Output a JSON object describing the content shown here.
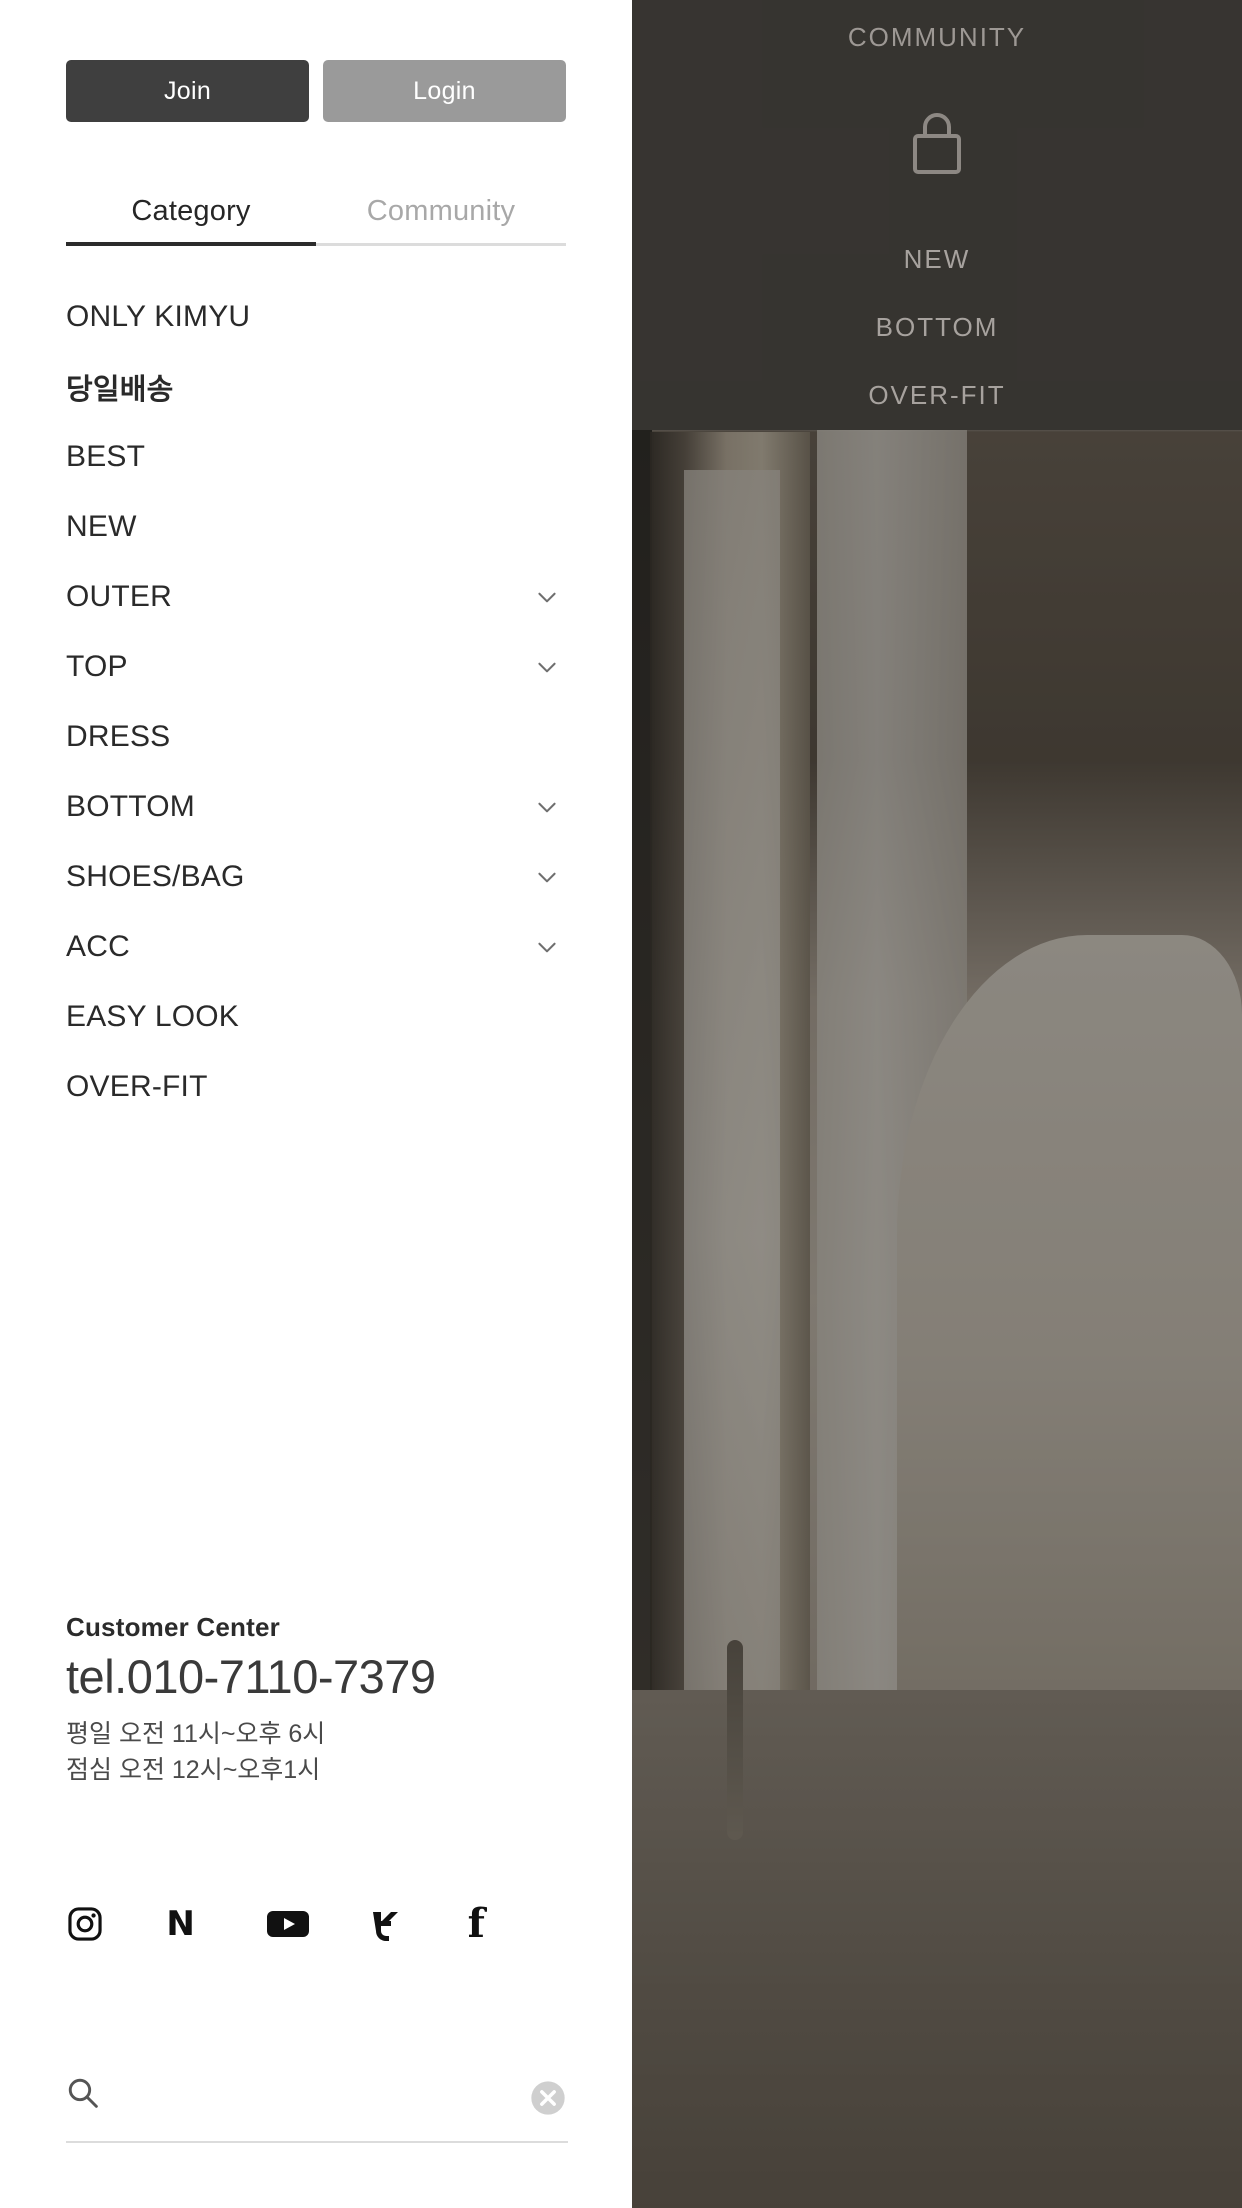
{
  "auth": {
    "join_label": "Join",
    "login_label": "Login",
    "join_color": "#3f3f3f",
    "login_color": "#9a9a9a"
  },
  "tabs": [
    {
      "label": "Category",
      "active": true
    },
    {
      "label": "Community",
      "active": false
    }
  ],
  "tab_indicator_color": "#2b2b2b",
  "categories": [
    {
      "label": "ONLY KIMYU",
      "expandable": false,
      "korean": false
    },
    {
      "label": "당일배송",
      "expandable": false,
      "korean": true
    },
    {
      "label": "BEST",
      "expandable": false,
      "korean": false
    },
    {
      "label": "NEW",
      "expandable": false,
      "korean": false
    },
    {
      "label": "OUTER",
      "expandable": true,
      "korean": false
    },
    {
      "label": "TOP",
      "expandable": true,
      "korean": false
    },
    {
      "label": "DRESS",
      "expandable": false,
      "korean": false
    },
    {
      "label": "BOTTOM",
      "expandable": true,
      "korean": false
    },
    {
      "label": "SHOES/BAG",
      "expandable": true,
      "korean": false
    },
    {
      "label": "ACC",
      "expandable": true,
      "korean": false
    },
    {
      "label": "EASY LOOK",
      "expandable": false,
      "korean": false
    },
    {
      "label": "OVER-FIT",
      "expandable": false,
      "korean": false
    }
  ],
  "customer_center": {
    "title": "Customer Center",
    "tel": "tel.010-7110-7379",
    "hours_weekday": "평일 오전 11시~오후 6시",
    "hours_lunch": "점심 오전 12시~오후1시"
  },
  "social": [
    {
      "name": "instagram",
      "label": "Instagram"
    },
    {
      "name": "naver",
      "label": "N"
    },
    {
      "name": "youtube",
      "label": "YouTube"
    },
    {
      "name": "twitter",
      "label": "Twitter"
    },
    {
      "name": "facebook",
      "label": "f"
    }
  ],
  "search": {
    "value": "",
    "placeholder": ""
  },
  "background_nav": {
    "community": "COMMUNITY",
    "links": [
      "NEW",
      "BOTTOM",
      "OVER-FIT"
    ]
  }
}
